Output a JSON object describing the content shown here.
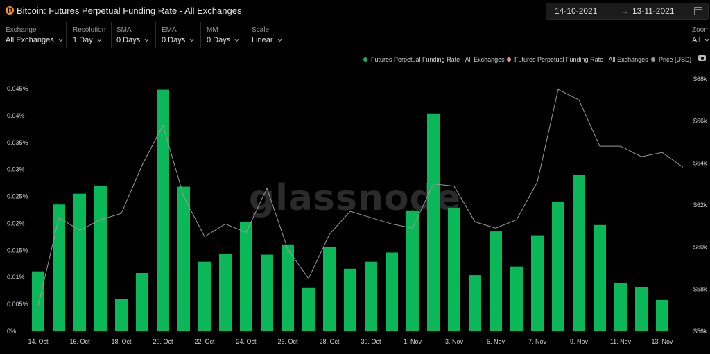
{
  "header": {
    "title": "Bitcoin: Futures Perpetual Funding Rate - All Exchanges",
    "coin_icon": "bitcoin-icon",
    "date_start": "14-10-2021",
    "date_arrow": "→",
    "date_end": "13-11-2021",
    "calendar_icon": "calendar-icon"
  },
  "controls": [
    {
      "label": "Exchange",
      "value": "All Exchanges"
    },
    {
      "label": "Resolution",
      "value": "1 Day"
    },
    {
      "label": "SMA",
      "value": "0 Days"
    },
    {
      "label": "EMA",
      "value": "0 Days"
    },
    {
      "label": "MM",
      "value": "0 Days"
    },
    {
      "label": "Scale",
      "value": "Linear"
    }
  ],
  "zoom": {
    "label": "Zoom",
    "value": "All"
  },
  "legend": [
    {
      "name": "Futures Perpetual Funding Rate - All Exchanges",
      "color": "#0ab85a"
    },
    {
      "name": "Futures Perpetual Funding Rate - All Exchanges",
      "color": "#f08c8c"
    },
    {
      "name": "Price [USD]",
      "color": "#9a9a9a"
    }
  ],
  "watermark": "glassnode",
  "chart_data": {
    "type": "bar",
    "x_tick_labels": [
      "14. Oct",
      "16. Oct",
      "18. Oct",
      "20. Oct",
      "22. Oct",
      "24. Oct",
      "26. Oct",
      "28. Oct",
      "30. Oct",
      "1. Nov",
      "3. Nov",
      "5. Nov",
      "7. Nov",
      "9. Nov",
      "11. Nov",
      "13. Nov"
    ],
    "y_left": {
      "ticks": [
        "0%",
        "0.005%",
        "0.01%",
        "0.015%",
        "0.02%",
        "0.025%",
        "0.03%",
        "0.035%",
        "0.04%",
        "0.045%"
      ],
      "range": [
        0,
        0.045
      ]
    },
    "y_right": {
      "ticks": [
        "$56k",
        "$58k",
        "$60k",
        "$62k",
        "$64k",
        "$66k",
        "$68k"
      ],
      "range": [
        56000,
        68000
      ]
    },
    "series": [
      {
        "name": "Futures Perpetual Funding Rate - All Exchanges",
        "type": "bar",
        "color": "#0ab85a",
        "axis": "left",
        "values": [
          0.0111,
          0.0235,
          0.0255,
          0.027,
          0.006,
          0.0108,
          0.0448,
          0.0268,
          0.0129,
          0.0143,
          0.0202,
          0.0142,
          0.0161,
          0.008,
          0.0156,
          0.0116,
          0.0129,
          0.0146,
          0.0224,
          0.0404,
          0.0229,
          0.0104,
          0.0185,
          0.012,
          0.0178,
          0.024,
          0.029,
          0.0197,
          0.009,
          0.0082,
          0.0058
        ]
      },
      {
        "name": "Price [USD]",
        "type": "line",
        "color": "#9a9a9a",
        "axis": "right",
        "values": [
          57200,
          61400,
          60800,
          61300,
          61600,
          63900,
          65800,
          62400,
          60500,
          61100,
          60700,
          62800,
          59900,
          58500,
          60600,
          61700,
          61400,
          61100,
          60900,
          63000,
          62900,
          61200,
          60900,
          61300,
          63100,
          67500,
          67000,
          64800,
          64800,
          64300,
          64500,
          63800
        ]
      }
    ],
    "grid": true,
    "legend_position": "top-right"
  }
}
